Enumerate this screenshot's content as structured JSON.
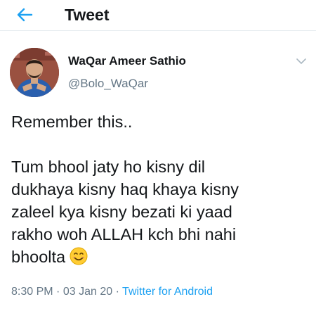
{
  "header": {
    "title": "Tweet"
  },
  "author": {
    "display_name": "WaQar Ameer Sathio",
    "handle": "@Bolo_WaQar"
  },
  "tweet": {
    "line1": "Remember this..",
    "body": "Tum bhool jaty ho kisny dil\ndukhaya kisny haq khaya kisny\nzaleel kya kisny bezati ki yaad\nrakho woh ALLAH kch bhi nahi\nbhoolta",
    "emoji": "smiling-face-with-smiling-eyes"
  },
  "meta": {
    "time": "8:30 PM",
    "separator1": "·",
    "date": "03 Jan 20",
    "separator2": "·",
    "source": "Twitter for Android"
  },
  "colors": {
    "accent": "#1da1f2",
    "text": "#14171a",
    "secondary": "#657786"
  }
}
